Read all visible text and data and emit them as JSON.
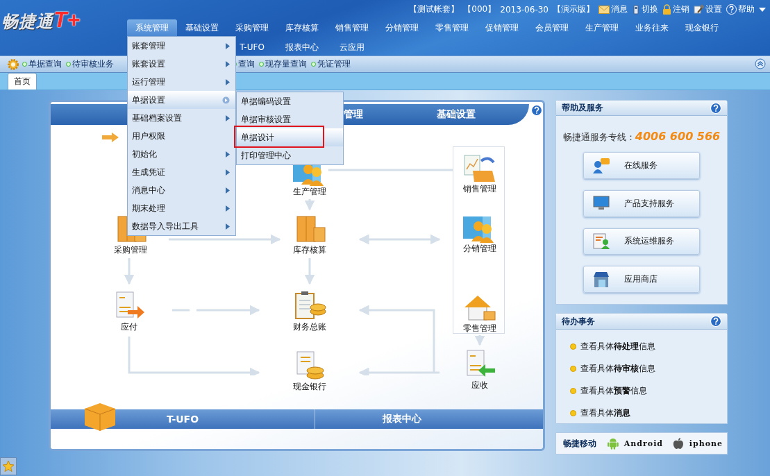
{
  "app": {
    "logo": "畅捷通",
    "logo_mark": "T+"
  },
  "account_info": [
    "【测试帐套】",
    "【000】",
    "2013-06-30",
    "【演示版】"
  ],
  "top_links": [
    "消息",
    "切换",
    "注销",
    "设置",
    "帮助"
  ],
  "main_menu": [
    {
      "label": "系统管理",
      "selected": true
    },
    {
      "label": "基础设置",
      "selected": false
    },
    {
      "label": "采购管理",
      "selected": false
    },
    {
      "label": "库存核算",
      "selected": false
    },
    {
      "label": "销售管理",
      "selected": false
    },
    {
      "label": "分销管理",
      "selected": false
    },
    {
      "label": "零售管理",
      "selected": false
    },
    {
      "label": "促销管理",
      "selected": false
    },
    {
      "label": "会员管理",
      "selected": false
    },
    {
      "label": "生产管理",
      "selected": false
    },
    {
      "label": "业务往来",
      "selected": false
    },
    {
      "label": "现金银行",
      "selected": false
    }
  ],
  "main_menu_row2": [
    "T-UFO",
    "报表中心",
    "云应用"
  ],
  "quick_bar": [
    "单据查询",
    "待审核业务",
    "查询",
    "现存量查询",
    "凭证管理"
  ],
  "tabs": [
    {
      "label": "首页",
      "selected": true
    }
  ],
  "dropdown": [
    {
      "label": "账套管理",
      "has_submenu": true,
      "selected": false
    },
    {
      "label": "账套设置",
      "has_submenu": true,
      "selected": false
    },
    {
      "label": "运行管理",
      "has_submenu": true,
      "selected": false
    },
    {
      "label": "单据设置",
      "has_submenu": true,
      "selected": true
    },
    {
      "label": "基础档案设置",
      "has_submenu": true,
      "selected": false
    },
    {
      "label": "用户权限",
      "has_submenu": false,
      "selected": false
    },
    {
      "label": "初始化",
      "has_submenu": true,
      "selected": false
    },
    {
      "label": "生成凭证",
      "has_submenu": true,
      "selected": false
    },
    {
      "label": "消息中心",
      "has_submenu": true,
      "selected": false
    },
    {
      "label": "期末处理",
      "has_submenu": true,
      "selected": false
    },
    {
      "label": "数据导入导出工具",
      "has_submenu": true,
      "selected": false
    }
  ],
  "submenu": [
    {
      "label": "单据编码设置",
      "selected": false,
      "marked": false
    },
    {
      "label": "单据审核设置",
      "selected": false,
      "marked": false
    },
    {
      "label": "单据设计",
      "selected": true,
      "marked": true
    },
    {
      "label": "打印管理中心",
      "selected": false,
      "marked": false
    }
  ],
  "main_panel": {
    "header_tabs": [
      "管理",
      "基础设置"
    ],
    "nodes": [
      {
        "label": "生产管理"
      },
      {
        "label": "销售管理"
      },
      {
        "label": "采购管理"
      },
      {
        "label": "库存核算"
      },
      {
        "label": "分销管理"
      },
      {
        "label": "应付"
      },
      {
        "label": "财务总账"
      },
      {
        "label": "零售管理"
      },
      {
        "label": "现金银行"
      },
      {
        "label": "应收"
      }
    ],
    "footer_tabs": [
      "T-UFO",
      "报表中心"
    ]
  },
  "help_panel": {
    "title": "帮助及服务",
    "hotline_label": "畅捷通服务专线：",
    "hotline": "4006 600 566",
    "buttons": [
      "在线服务",
      "产品支持服务",
      "系统运维服务",
      "应用商店"
    ]
  },
  "todo_panel": {
    "title": "待办事务",
    "items": [
      "查看具体**待处理**信息",
      "查看具体**待审核**信息",
      "查看具体**预警**信息",
      "查看具体**消息**"
    ]
  },
  "mobile_bar": {
    "title": "畅捷移动",
    "platforms": [
      "Android",
      "iphone"
    ]
  }
}
